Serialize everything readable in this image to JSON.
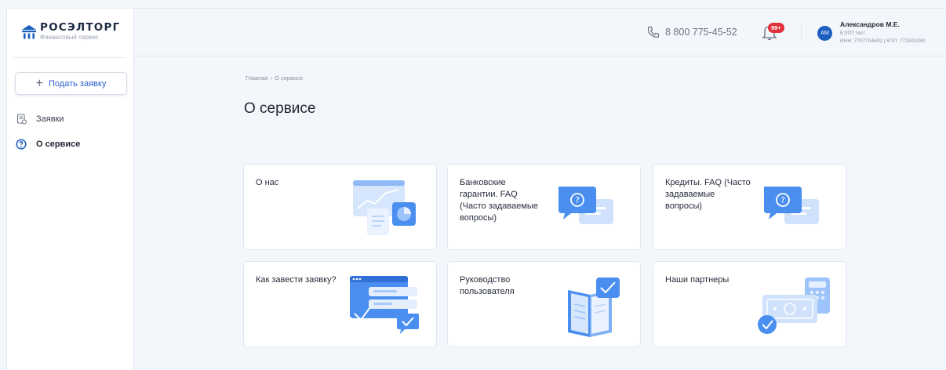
{
  "brand": {
    "name": "РОСЭЛТОРГ",
    "subtitle": "Финансовый сервис",
    "color": "#1b5fbf"
  },
  "sidebar": {
    "apply_button": "Подать заявку",
    "items": [
      {
        "label": "Заявки",
        "icon": "document-icon",
        "active": false
      },
      {
        "label": "О сервисе",
        "icon": "help-circle-icon",
        "active": true
      }
    ]
  },
  "header": {
    "phone": "8 800 775-45-52",
    "notifications_badge": "99+",
    "avatar_initials": "АМ",
    "user_name": "Александров М.Е.",
    "user_org": "ЕЭТП тест",
    "user_ids": "ИНН: 7707704692 | КПП: 772501080"
  },
  "breadcrumb": {
    "home": "Главная",
    "separator": "›",
    "current": "О сервисе"
  },
  "page": {
    "title": "О сервисе"
  },
  "cards": [
    {
      "label": "О нас",
      "icon": "dashboard-chart-illustration"
    },
    {
      "label": "Банковские гарантии. FAQ (Часто задаваемые вопросы)",
      "icon": "faq-chat-bubbles-illustration"
    },
    {
      "label": "Кредиты. FAQ (Часто задаваемые вопросы)",
      "icon": "faq-chat-bubbles-illustration"
    },
    {
      "label": "Как завести заявку?",
      "icon": "application-window-illustration"
    },
    {
      "label": "Руководство пользователя",
      "icon": "open-book-illustration"
    },
    {
      "label": "Наши партнеры",
      "icon": "money-calculator-illustration"
    }
  ],
  "colors": {
    "accent": "#2b5fcf",
    "badge": "#e0323a",
    "illustration_blue": "#4a8ef0",
    "illustration_light": "#cfe1fb"
  }
}
